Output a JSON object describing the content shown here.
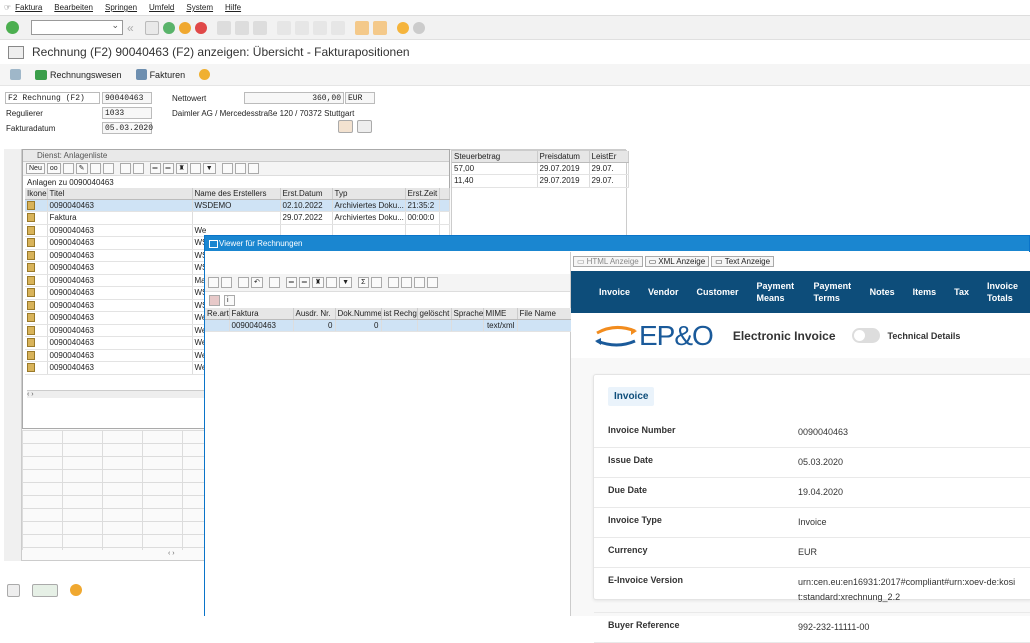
{
  "menu": [
    "Faktura",
    "Bearbeiten",
    "Springen",
    "Umfeld",
    "System",
    "Hilfe"
  ],
  "title": "Rechnung (F2) 90040463  (F2) anzeigen: Übersicht - Fakturapositionen",
  "apptoolbar": {
    "rechnungswesen": "Rechnungswesen",
    "fakturen": "Fakturen"
  },
  "header": {
    "doctype_value": "F2 Rechnung (F2)",
    "doc_number": "90040463",
    "nettowert_label": "Nettowert",
    "nettowert_value": "360,00",
    "currency": "EUR",
    "regulierer_label": "Regulierer",
    "regulierer_value": "1033",
    "regulierer_name": "Daimler AG / Mercedesstraße 120 / 70372 Stuttgart",
    "fakturadatum_label": "Fakturadatum",
    "fakturadatum_value": "05.03.2020"
  },
  "right_grid": {
    "headers": [
      "Steuerbetrag",
      "Preisdatum",
      "LeistEr"
    ],
    "rows": [
      [
        "57,00",
        "29.07.2019",
        "29.07."
      ],
      [
        "11,40",
        "29.07.2019",
        "29.07."
      ]
    ]
  },
  "anlagen": {
    "title": "Dienst: Anlagenliste",
    "neu_label": "Neu",
    "subtitle": "Anlagen zu 0090040463",
    "headers": [
      "Ikone",
      "Titel",
      "Name des Erstellers",
      "Erst.Datum",
      "Typ",
      "Erst.Zeit"
    ],
    "rows": [
      [
        "0090040463",
        "WSDEMO",
        "02.10.2022",
        "Archiviertes Doku...",
        "21:35:2"
      ],
      [
        "Faktura",
        "",
        "29.07.2022",
        "Archiviertes Doku...",
        "00:00:0"
      ],
      [
        "0090040463",
        "We",
        "",
        "",
        ""
      ],
      [
        "0090040463",
        "WS",
        "",
        "",
        ""
      ],
      [
        "0090040463",
        "WS",
        "",
        "",
        ""
      ],
      [
        "0090040463",
        "WS",
        "",
        "",
        ""
      ],
      [
        "0090040463",
        "Ma",
        "",
        "",
        ""
      ],
      [
        "0090040463",
        "WS",
        "",
        "",
        ""
      ],
      [
        "0090040463",
        "WS",
        "",
        "",
        ""
      ],
      [
        "0090040463",
        "We",
        "",
        "",
        ""
      ],
      [
        "0090040463",
        "We",
        "",
        "",
        ""
      ],
      [
        "0090040463",
        "We",
        "",
        "",
        ""
      ],
      [
        "0090040463",
        "We",
        "",
        "",
        ""
      ],
      [
        "0090040463",
        "We",
        "",
        "",
        ""
      ]
    ]
  },
  "viewer": {
    "title": "Viewer für Rechnungen",
    "list_headers": [
      "Re.art",
      "Faktura",
      "Ausdr. Nr.",
      "Dok.Nummer",
      "ist Rechg.",
      "gelöscht",
      "Sprache",
      "MIME",
      "File Name"
    ],
    "list_row": [
      "",
      "0090040463",
      "0",
      "0",
      "",
      "",
      "",
      "text/xml",
      ""
    ],
    "tabs": [
      "HTML Anzeige",
      "XML Anzeige",
      "Text Anzeige"
    ],
    "nav": [
      "Invoice",
      "Vendor",
      "Customer",
      "Payment Means",
      "Payment Terms",
      "Notes",
      "Items",
      "Tax",
      "Invoice Totals"
    ],
    "logo_text": "EP&O",
    "einvoice_title": "Electronic Invoice",
    "technical_details": "Technical Details",
    "card_heading": "Invoice",
    "fields": [
      {
        "k": "Invoice Number",
        "v": "0090040463"
      },
      {
        "k": "Issue Date",
        "v": "05.03.2020"
      },
      {
        "k": "Due Date",
        "v": "19.04.2020"
      },
      {
        "k": "Invoice Type",
        "v": "Invoice"
      },
      {
        "k": "Currency",
        "v": "EUR"
      },
      {
        "k": "E-Invoice Version",
        "v": "urn:cen.eu:en16931:2017#compliant#urn:xoev-de:kosit:standard:xrechnung_2.2"
      },
      {
        "k": "Buyer Reference",
        "v": "992-232-11111-00"
      }
    ]
  },
  "colors": {
    "nav_bg": "#0d4d7a",
    "viewer_title": "#1a86d0",
    "selection": "#cfe3f5",
    "logo_orange": "#f28c1e",
    "logo_blue": "#1a5a9a"
  }
}
